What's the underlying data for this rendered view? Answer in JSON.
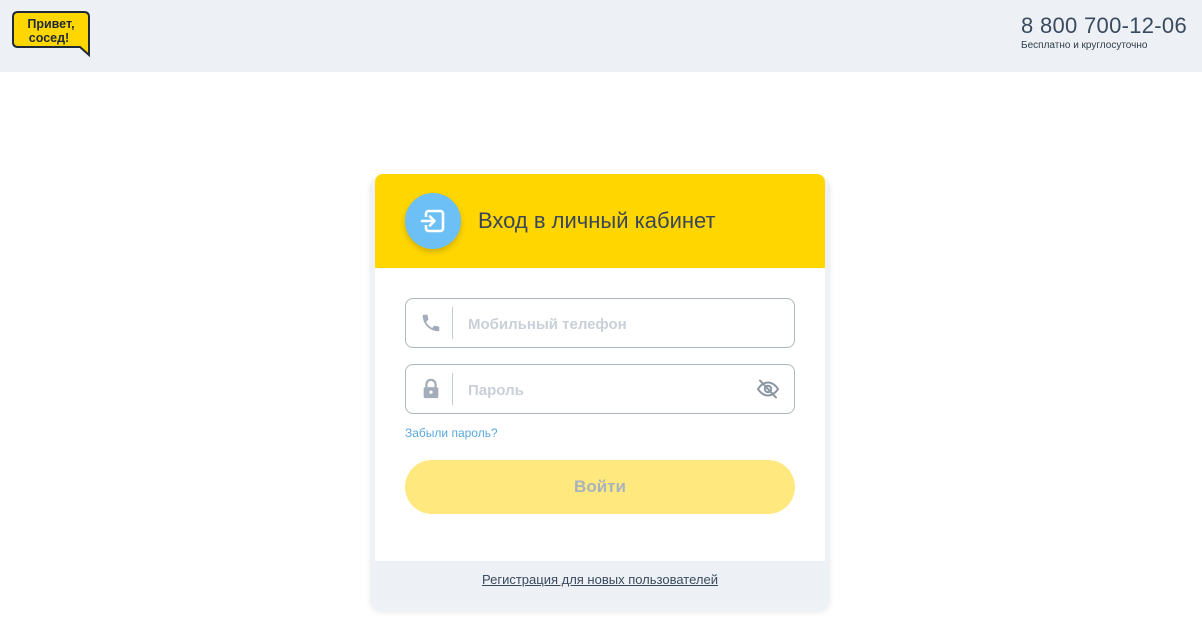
{
  "header": {
    "logo_text_line1": "Привет,",
    "logo_text_line2": "сосед!",
    "phone": "8 800 700-12-06",
    "phone_note": "Бесплатно и круглосуточно"
  },
  "login": {
    "title": "Вход в личный кабинет",
    "phone_placeholder": "Мобильный телефон",
    "phone_value": "",
    "password_placeholder": "Пароль",
    "password_value": "",
    "forgot_label": "Забыли пароль?",
    "submit_label": "Войти",
    "register_label": "Регистрация для новых пользователей"
  },
  "icons": {
    "login": "login-icon",
    "phone": "phone-icon",
    "lock": "lock-icon",
    "eye": "eye-off-icon"
  },
  "colors": {
    "brand_yellow": "#ffd600",
    "button_disabled": "#ffe97e",
    "accent_blue": "#6cc0f5",
    "link_blue": "#5aa8dd",
    "header_bg": "#edf1f5"
  }
}
